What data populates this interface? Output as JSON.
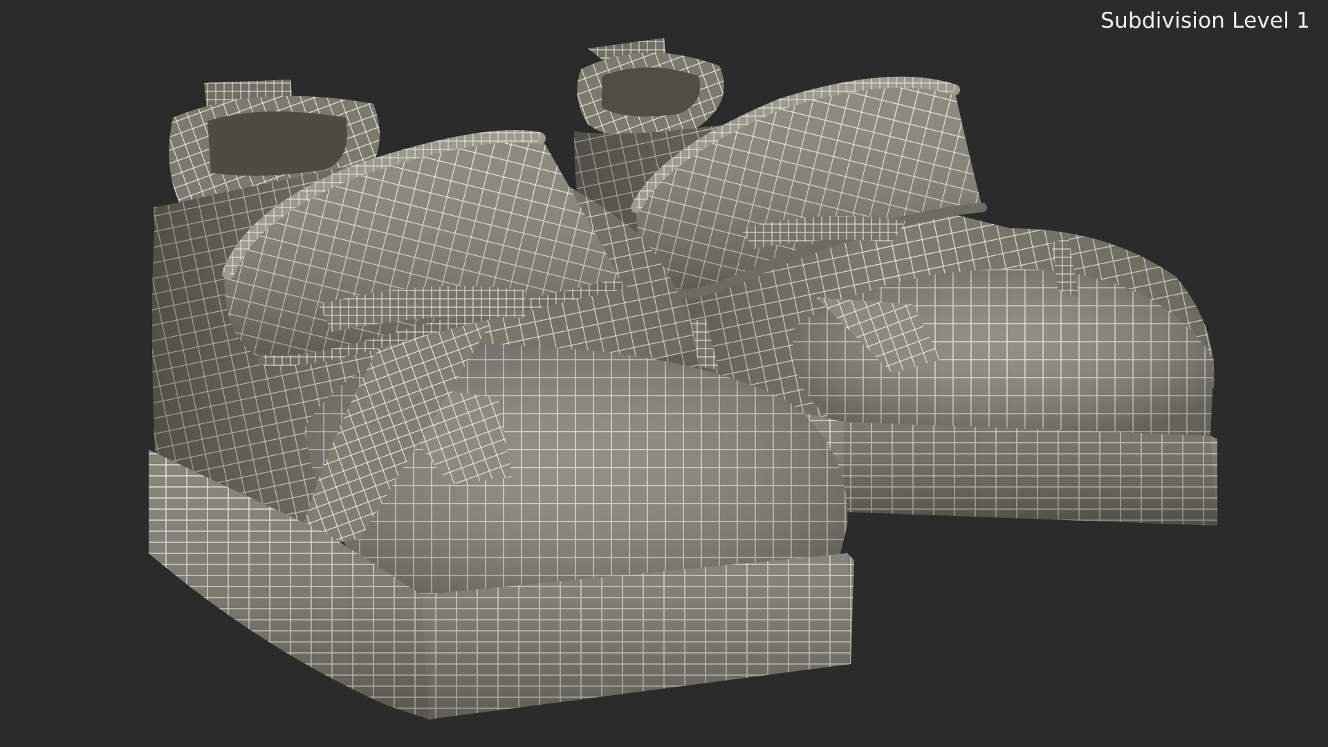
{
  "viewport": {
    "label": "Subdivision Level 1",
    "background": "#2b2b2b"
  },
  "render": {
    "subject": "pair of baby shoes with hook-and-loop straps",
    "surface_color": "#7d7d71",
    "wire_color": "#eeeee6"
  }
}
